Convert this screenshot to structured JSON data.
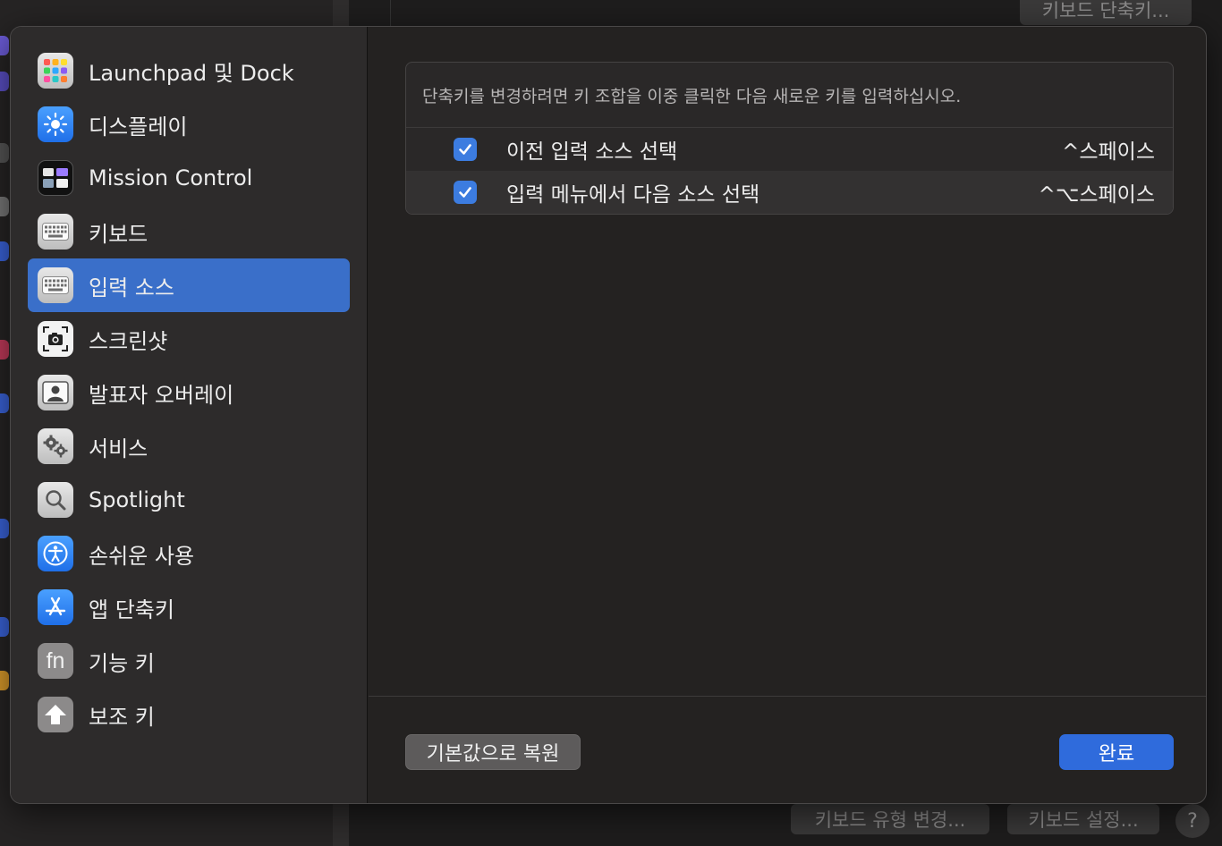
{
  "background_window": {
    "top_button": "키보드 단축키...",
    "bottom_buttons": [
      "키보드 유형 변경...",
      "키보드 설정..."
    ],
    "help_label": "?"
  },
  "sidebar": {
    "items": [
      {
        "label": "Launchpad 및 Dock",
        "icon": "launchpad-grid-icon"
      },
      {
        "label": "디스플레이",
        "icon": "brightness-sun-icon"
      },
      {
        "label": "Mission Control",
        "icon": "mission-control-icon"
      },
      {
        "label": "키보드",
        "icon": "keyboard-icon"
      },
      {
        "label": "입력 소스",
        "icon": "keyboard-icon",
        "selected": true
      },
      {
        "label": "스크린샷",
        "icon": "screenshot-camera-icon"
      },
      {
        "label": "발표자 오버레이",
        "icon": "presenter-overlay-icon"
      },
      {
        "label": "서비스",
        "icon": "gears-icon"
      },
      {
        "label": "Spotlight",
        "icon": "magnifier-icon"
      },
      {
        "label": "손쉬운 사용",
        "icon": "accessibility-icon"
      },
      {
        "label": "앱 단축키",
        "icon": "app-store-icon"
      },
      {
        "label": "기능 키",
        "icon": "fn-key-icon"
      },
      {
        "label": "보조 키",
        "icon": "modifier-arrow-icon"
      }
    ],
    "selected_color": "#3a6fc9"
  },
  "main": {
    "hint": "단축키를 변경하려면 키 조합을 이중 클릭한 다음 새로운 키를 입력하십시오.",
    "shortcuts": [
      {
        "label": "이전 입력 소스 선택",
        "keys": "^스페이스",
        "checked": true
      },
      {
        "label": "입력 메뉴에서 다음 소스 선택",
        "keys": "^⌥스페이스",
        "checked": true
      }
    ],
    "restore_button": "기본값으로 복원",
    "done_button": "완료",
    "accent_color": "#2f6bdc"
  }
}
